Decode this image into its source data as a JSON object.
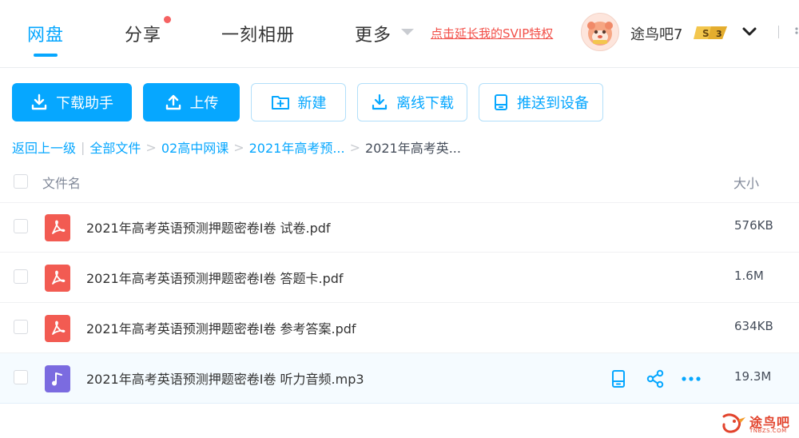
{
  "nav": {
    "items": [
      {
        "label": "网盘",
        "active": true
      },
      {
        "label": "分享",
        "active": false,
        "has_notification_dot": true
      },
      {
        "label": "一刻相册",
        "active": false
      },
      {
        "label": "更多",
        "active": false,
        "has_dropdown": true
      }
    ],
    "promo_link": "点击延长我的SVIP特权",
    "user": {
      "name": "途鸟吧7",
      "badge_level": "3",
      "badge_symbol": "S"
    }
  },
  "toolbar": {
    "download_helper": "下载助手",
    "upload": "上传",
    "new_folder": "新建",
    "offline_download": "离线下载",
    "push_to_device": "推送到设备"
  },
  "breadcrumb": {
    "back": "返回上一级",
    "all_files": "全部文件",
    "crumbs": [
      "02高中网课",
      "2021年高考预..."
    ],
    "current": "2021年高考英..."
  },
  "table": {
    "headers": {
      "name": "文件名",
      "size": "大小"
    },
    "rows": [
      {
        "name": "2021年高考英语预测押题密卷I卷 试卷.pdf",
        "size": "576KB",
        "type": "pdf"
      },
      {
        "name": "2021年高考英语预测押题密卷I卷 答题卡.pdf",
        "size": "1.6M",
        "type": "pdf"
      },
      {
        "name": "2021年高考英语预测押题密卷I卷 参考答案.pdf",
        "size": "634KB",
        "type": "pdf"
      },
      {
        "name": "2021年高考英语预测押题密卷I卷 听力音频.mp3",
        "size": "19.3M",
        "type": "audio",
        "hovered": true
      }
    ]
  },
  "watermark": {
    "text": "途鸟吧",
    "sub": "TNBZS.COM"
  },
  "colors": {
    "accent": "#06a7ff",
    "promo": "#f24f48",
    "pdf_icon": "#f25b52",
    "audio_icon": "#7b6be0"
  }
}
